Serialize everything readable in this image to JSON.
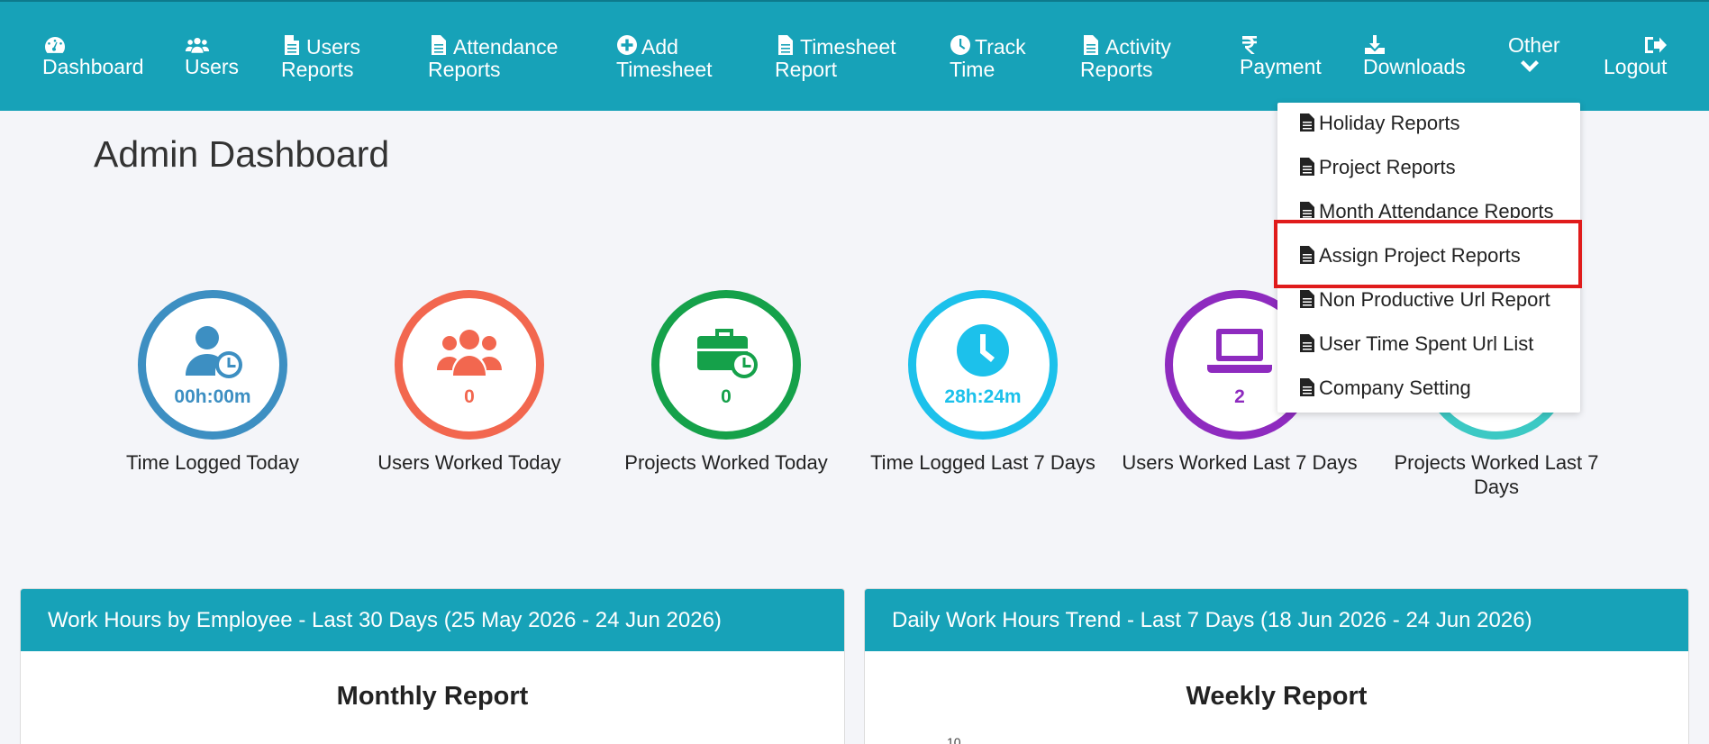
{
  "nav": {
    "dashboard": "Dashboard",
    "users": "Users",
    "users_reports": [
      "Users",
      "Reports"
    ],
    "attendance_reports": [
      "Attendance",
      "Reports"
    ],
    "add_timesheet": [
      "Add",
      "Timesheet"
    ],
    "timesheet_report": [
      "Timesheet",
      "Report"
    ],
    "track_time": [
      "Track",
      "Time"
    ],
    "activity_reports": [
      "Activity",
      "Reports"
    ],
    "payment": "Payment",
    "downloads": "Downloads",
    "other": "Other",
    "logout": "Logout"
  },
  "page_title": "Admin Dashboard",
  "stats": [
    {
      "value": "00h:00m",
      "label": "Time Logged Today",
      "color": "#3d8fc2",
      "icon": "user-clock-icon"
    },
    {
      "value": "0",
      "label": "Users Worked Today",
      "color": "#f2674f",
      "icon": "users-icon"
    },
    {
      "value": "0",
      "label": "Projects Worked Today",
      "color": "#15a14a",
      "icon": "briefcase-clock-icon"
    },
    {
      "value": "28h:24m",
      "label": "Time Logged Last 7 Days",
      "color": "#1cc1eb",
      "icon": "clock-icon"
    },
    {
      "value": "2",
      "label": "Users Worked Last 7 Days",
      "color": "#8e2bbf",
      "icon": "laptop-icon"
    },
    {
      "value": "",
      "label": "Projects Worked Last 7 Days",
      "color": "#3cc9c4",
      "icon": "projects-icon"
    }
  ],
  "dropdown": {
    "items": [
      "Holiday Reports",
      "Project Reports",
      "Month Attendance Reports",
      "Assign Project Reports",
      "Non Productive Url Report",
      "User Time Spent Url List",
      "Company Setting"
    ],
    "highlighted": "Assign Project Reports"
  },
  "panels": [
    {
      "header": "Work Hours by Employee - Last 30 Days (25 May 2026 - 24 Jun 2026)",
      "title": "Monthly Report"
    },
    {
      "header": "Daily Work Hours Trend - Last 7 Days (18 Jun 2026 - 24 Jun 2026)",
      "title": "Weekly Report",
      "tick": "10"
    }
  ],
  "colors": {
    "navbar": "#17a2b8",
    "highlight_box": "#e01b1b"
  }
}
